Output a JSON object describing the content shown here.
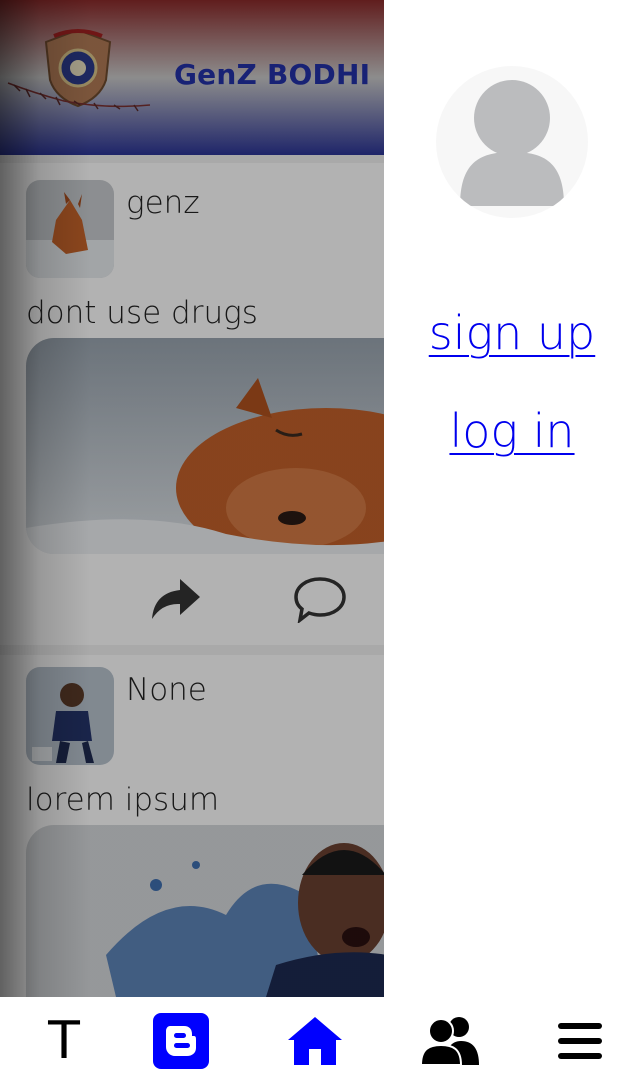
{
  "header": {
    "brand": "GenZ BODHI"
  },
  "posts": [
    {
      "username": "genz",
      "caption": "dont use drugs",
      "image": "fox-sleeping-in-snow"
    },
    {
      "username": "None",
      "caption": "lorem ipsum",
      "image": "footballer-celebrating"
    }
  ],
  "post_actions": [
    "share-icon",
    "comment-icon"
  ],
  "drawer": {
    "avatar_icon": "user-icon",
    "signup_label": "sign up",
    "login_label": "log in"
  },
  "bottom_nav": {
    "items": [
      {
        "label": "T",
        "icon": "text-icon",
        "color": "#000000"
      },
      {
        "icon": "blogger-icon",
        "color": "#0000ff"
      },
      {
        "icon": "home-icon",
        "color": "#0000ff"
      },
      {
        "icon": "users-icon",
        "color": "#000000"
      },
      {
        "icon": "menu-icon",
        "color": "#000000"
      }
    ]
  },
  "colors": {
    "link": "#0000ee",
    "accent": "#0000ff",
    "brand": "#2330a8"
  }
}
